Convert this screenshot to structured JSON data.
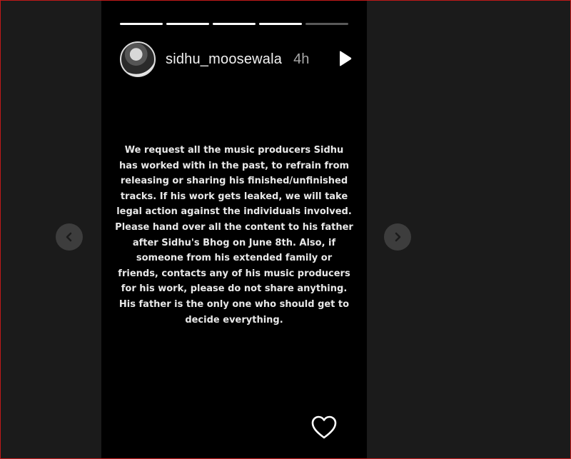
{
  "story": {
    "username": "sidhu_moosewala",
    "time": "4h",
    "progress_segments": 5,
    "progress_completed": 4,
    "message_lines": [
      "We request all the music producers Sidhu",
      "has worked with in the past, to refrain from",
      "releasing or sharing his finished/unfinished",
      "tracks. If his work gets leaked, we will take",
      "legal action against the individuals involved.",
      "Please hand over all the content to his father",
      "after Sidhu's Bhog on June 8th. Also, if",
      "someone from his extended family or",
      "friends, contacts any of his music producers",
      "for his work, please do not share anything.",
      "His father is the only one who should get to",
      "decide everything."
    ]
  },
  "icons": {
    "play": "play-icon",
    "mute": "mute-icon",
    "more": "more-options-icon",
    "like": "heart-icon",
    "prev": "chevron-left-icon",
    "next": "chevron-right-icon"
  },
  "colors": {
    "story_bg": "#000000",
    "viewer_bg": "#1b1b1b",
    "text": "#e8e8e8",
    "nav_button": "#3d3d3d",
    "frame_border": "#c01a1a"
  }
}
